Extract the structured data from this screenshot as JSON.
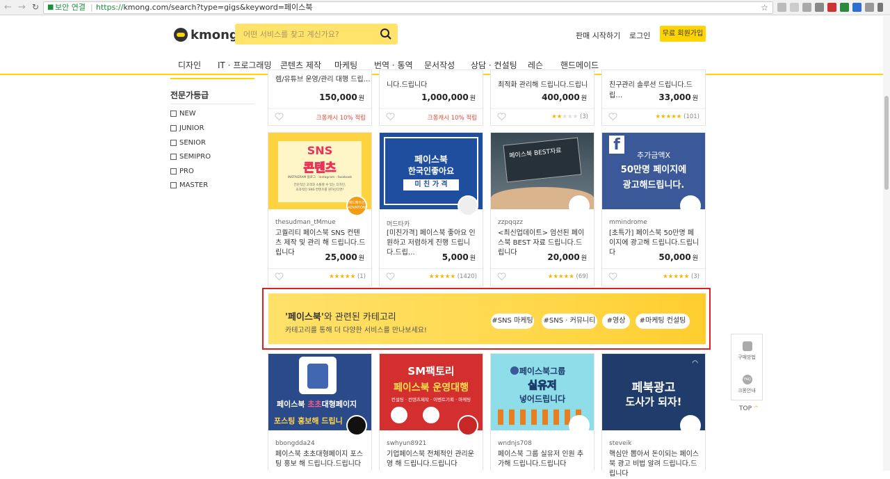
{
  "browser": {
    "secure_label": "보안 연결",
    "url_scheme": "https://",
    "url_rest": "kmong.com/search?type=gigs&keyword=페이스북"
  },
  "header": {
    "logo": "kmong",
    "search_placeholder": "어떤 서비스를 찾고 계신가요?",
    "start_selling": "판매 시작하기",
    "login": "로그인",
    "signup": "무료 회원가입"
  },
  "menu": [
    "디자인",
    "IT · 프로그래밍",
    "콘텐츠 제작",
    "마케팅",
    "번역 · 통역",
    "문서작성",
    "상담 · 컨설팅",
    "레슨",
    "핸드메이드"
  ],
  "sidebar": {
    "title": "전문가등급",
    "levels": [
      "NEW",
      "JUNIOR",
      "SENIOR",
      "SEMIPRO",
      "PRO",
      "MASTER"
    ]
  },
  "top_row": [
    {
      "desc": "렘/유튜브 운영/관리 대행 드립…",
      "price": "150,000",
      "won": "원",
      "badge": "크몽캐시 10% 적립"
    },
    {
      "desc": "니다.드립니다",
      "price": "1,000,000",
      "won": "원",
      "badge": "크몽캐시 10% 적립"
    },
    {
      "desc": "최적화 관리해 드립니다.드립니",
      "price": "400,000",
      "won": "원",
      "rating": 2,
      "count": "(3)"
    },
    {
      "desc": "친구관리 솔루션 드립니다.드립…",
      "price": "33,000",
      "won": "원",
      "rating": 5,
      "count": "(101)"
    }
  ],
  "mid_row": [
    {
      "seller": "thesudman_tMmue",
      "title": "고퀄리티 페이스북 SNS 컨텐츠 제작 및 관리 해 드립니다.드립니다",
      "price": "25,000",
      "won": "원",
      "rating": 5,
      "count": "(1)",
      "thumb_main": "SNS",
      "thumb_sub": "콘텐츠",
      "thumb_line1": "INSTAGRAM 블로그 · Instagram · facebook",
      "thumb_line2": "전문적인 고객과 소통할 수 있는 디자인,",
      "thumb_line3": "효과적인 SNS 컨텐츠를 원하신다면!",
      "avatar_text": "애드페이션 ADVATION"
    },
    {
      "seller": "머드타카",
      "title": "[미친가격] 페이스북 좋아요 인원하고 저렴하게 진행 드립니다.드립…",
      "price": "5,000",
      "won": "원",
      "rating": 5,
      "count": "(1420)",
      "thumb_main": "페이스북",
      "thumb_sub": "한국인좋아요",
      "thumb_line1": "미 친 가 격"
    },
    {
      "seller": "zzpqqzz",
      "title": "<최신업데이트> 엄선된 페이스북 BEST 자료 드립니다.드립니다",
      "price": "20,000",
      "won": "원",
      "rating": 5,
      "count": "(69)",
      "thumb_main": "페이스북 BEST자료"
    },
    {
      "seller": "mmindrome",
      "title": "[초특가] 페이스북 50만명 페이지에 광고해 드립니다.드립니다",
      "price": "50,000",
      "won": "원",
      "rating": 5,
      "count": "(3)",
      "thumb_main": "추가금액X",
      "thumb_sub": "50만명 페이지에",
      "thumb_line1": "광고해드립니다."
    }
  ],
  "banner": {
    "title_quote": "'페이스북'",
    "title_rest": "와 관련된 카테고리",
    "subtitle": "카테고리를 통해 더 다양한 서비스를 만나보세요!",
    "tags": [
      "#SNS 마케팅",
      "#SNS · 커뮤니티",
      "#영상",
      "#마케팅 컨설팅"
    ]
  },
  "bottom_row": [
    {
      "seller": "bbongdda24",
      "title": "페이스북 초초대형페이지 포스팅 홍보 해 드립니다.드립니다",
      "thumb_main": "페이스북",
      "thumb_hl": "초초",
      "thumb_main2": "대형페이지",
      "thumb_sub": "포스팅 홍보해 드립니"
    },
    {
      "seller": "swhyun8921",
      "title": "기업페이스북 전체적인 관리운영 해 드립니다.드립니다",
      "thumb_main": "SM팩토리",
      "thumb_sub": "페이스북 운영대행",
      "thumb_line1": "컨설팅 · 컨텐츠제작 · 이벤트기획 · 마케팅"
    },
    {
      "seller": "wndnjs708",
      "title": "페이스북 그룹 실유저 인원 추가해 드립니다.드립니다",
      "thumb_main": "페이스북그룹",
      "thumb_sub": "실유저",
      "thumb_line1": "넣어드립니다"
    },
    {
      "seller": "steveik",
      "title": "핵심만 뽑아서 돈이되는 페이스북 광고 비법 알려 드립니다.드립니다",
      "thumb_main": "페북광고",
      "thumb_sub": "도사가 되자!"
    }
  ],
  "floating": {
    "buy_guide": "구매방법",
    "faq": "크몽안내",
    "faq_icon": "FAQ",
    "top": "TOP"
  }
}
